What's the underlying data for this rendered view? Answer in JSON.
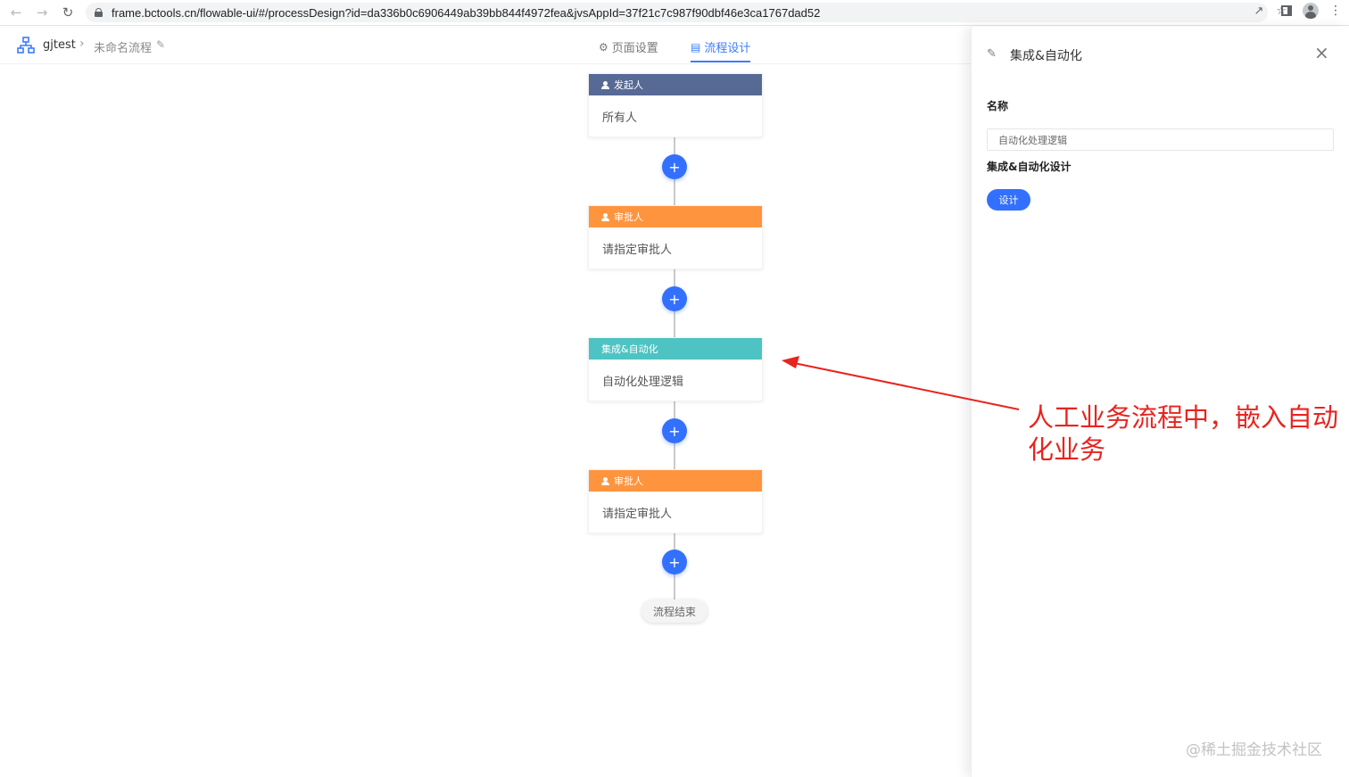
{
  "browser": {
    "url": "frame.bctools.cn/flowable-ui/#/processDesign?id=da336b0c6906449ab39bb844f4972fea&jvsAppId=37f21c7c987f90dbf46e3ca1767dad52"
  },
  "header": {
    "app_name": "gjtest",
    "flow_name": "未命名流程",
    "tabs": [
      {
        "label": "页面设置",
        "active": false
      },
      {
        "label": "流程设计",
        "active": true
      }
    ]
  },
  "flow": {
    "nodes": [
      {
        "type": "发起人",
        "body": "所有人",
        "color": "#576a95"
      },
      {
        "type": "审批人",
        "body": "请指定审批人",
        "color": "#ff943e"
      },
      {
        "type": "集成&自动化",
        "body": "自动化处理逻辑",
        "color": "#4dc3c3"
      },
      {
        "type": "审批人",
        "body": "请指定审批人",
        "color": "#ff943e"
      }
    ],
    "add_symbol": "+",
    "end_label": "流程结束"
  },
  "annotation": {
    "text": "人工业务流程中，嵌入自动化业务",
    "color": "#e8241f"
  },
  "drawer": {
    "title": "集成&自动化",
    "name_label": "名称",
    "name_value": "自动化处理逻辑",
    "design_label": "集成&自动化设计",
    "design_button": "设计",
    "close_symbol": "×"
  },
  "watermark": "@稀土掘金技术社区",
  "colors": {
    "accent": "#3370ff",
    "tab_active": "#3b7bff"
  }
}
